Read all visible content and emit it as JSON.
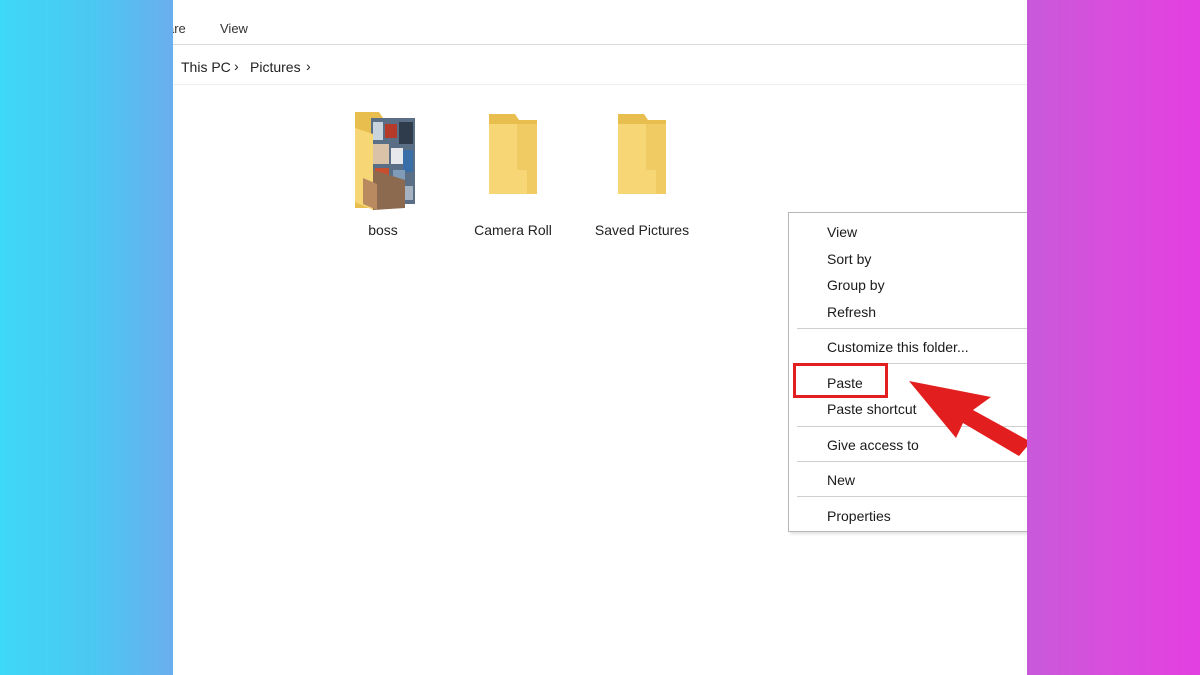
{
  "ribbon": {
    "tab_share": "are",
    "tab_view": "View"
  },
  "address": {
    "crumbs": [
      "This PC",
      "Pictures"
    ],
    "separator": "›"
  },
  "folders": [
    {
      "label": "boss",
      "has_thumbnail": true
    },
    {
      "label": "Camera Roll",
      "has_thumbnail": false
    },
    {
      "label": "Saved Pictures",
      "has_thumbnail": false
    }
  ],
  "context_menu": {
    "items": [
      "View",
      "Sort by",
      "Group by",
      "Refresh",
      "Customize this folder...",
      "Paste",
      "Paste shortcut",
      "Give access to",
      "New",
      "Properties"
    ],
    "highlighted_item": "Paste"
  },
  "colors": {
    "folder": "#f6d675",
    "folder_dark": "#e8bf4f",
    "highlight": "#e21e1e",
    "bg_left": "#3ed8f8",
    "bg_right": "#e43fe0"
  },
  "icons": {
    "folder_icon": "folder-icon",
    "breadcrumb_chevron": "chevron-right-icon",
    "annotation_arrow": "arrow-icon"
  }
}
